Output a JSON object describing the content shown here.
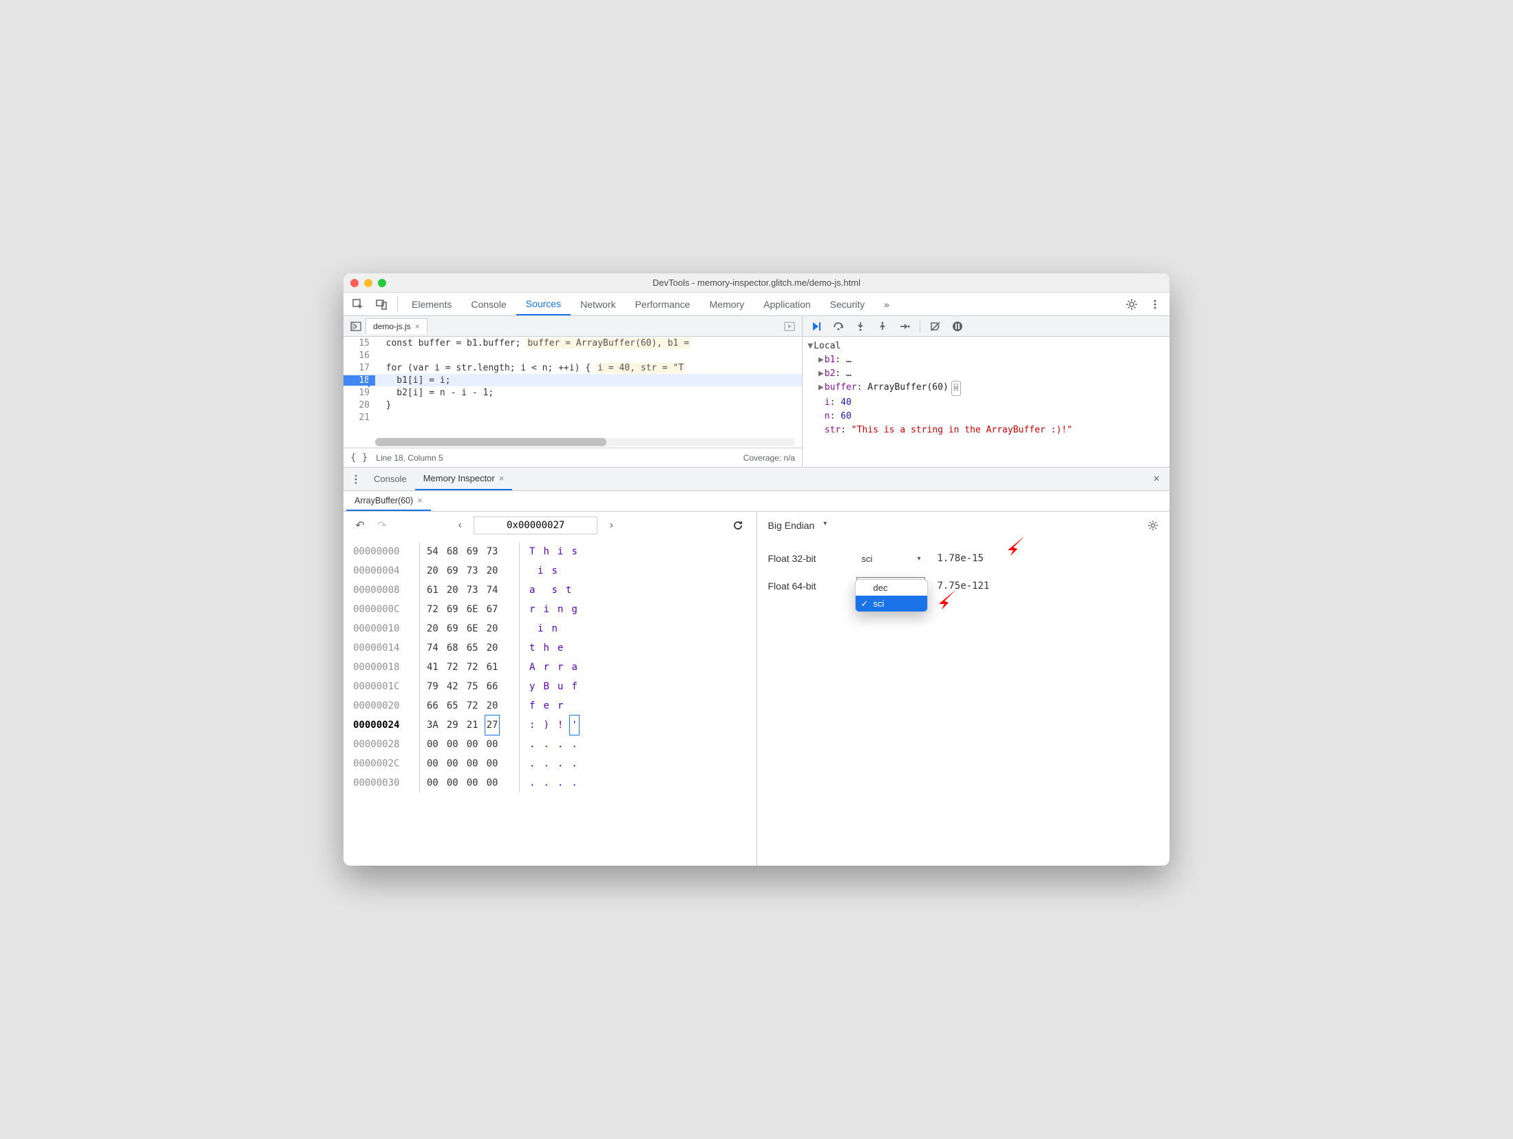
{
  "window": {
    "title": "DevTools - memory-inspector.glitch.me/demo-js.html"
  },
  "main_tabs": {
    "items": [
      "Elements",
      "Console",
      "Sources",
      "Network",
      "Performance",
      "Memory",
      "Application",
      "Security"
    ],
    "active": "Sources",
    "overflow": "»"
  },
  "file_tab": {
    "name": "demo-js.js"
  },
  "code": {
    "lines": [
      {
        "n": 15,
        "text": "const buffer = b1.buffer;",
        "hint": "buffer = ArrayBuffer(60), b1 ="
      },
      {
        "n": 16,
        "text": ""
      },
      {
        "n": 17,
        "text": "for (var i = str.length; i < n; ++i) {",
        "hint": "i = 40, str = \"T"
      },
      {
        "n": 18,
        "text": "  b1[i] = i;",
        "hl": true
      },
      {
        "n": 19,
        "text": "  b2[i] = n - i - 1;"
      },
      {
        "n": 20,
        "text": "}"
      },
      {
        "n": 21,
        "text": ""
      }
    ]
  },
  "status": {
    "pos": "Line 18, Column 5",
    "coverage": "Coverage: n/a"
  },
  "scope": {
    "header": "Local",
    "rows": [
      {
        "arrow": "▶",
        "key": "b1",
        "val": "…"
      },
      {
        "arrow": "▶",
        "key": "b2",
        "val": "…"
      },
      {
        "arrow": "▶",
        "key": "buffer",
        "val": "ArrayBuffer(60)",
        "mem": true
      },
      {
        "arrow": "",
        "key": "i",
        "val": "40",
        "num": true
      },
      {
        "arrow": "",
        "key": "n",
        "val": "60",
        "num": true
      },
      {
        "arrow": "",
        "key": "str",
        "val": "\"This is a string in the ArrayBuffer :)!\"",
        "str": true
      }
    ]
  },
  "drawer_tabs": {
    "items": [
      "Console",
      "Memory Inspector"
    ],
    "active": "Memory Inspector"
  },
  "mi_tab": {
    "label": "ArrayBuffer(60)"
  },
  "mi_nav": {
    "address": "0x00000027"
  },
  "hex": {
    "rows": [
      {
        "off": "00000000",
        "b": [
          "54",
          "68",
          "69",
          "73"
        ],
        "a": [
          "T",
          "h",
          "i",
          "s"
        ]
      },
      {
        "off": "00000004",
        "b": [
          "20",
          "69",
          "73",
          "20"
        ],
        "a": [
          " ",
          "i",
          "s",
          " "
        ]
      },
      {
        "off": "00000008",
        "b": [
          "61",
          "20",
          "73",
          "74"
        ],
        "a": [
          "a",
          " ",
          "s",
          "t"
        ]
      },
      {
        "off": "0000000C",
        "b": [
          "72",
          "69",
          "6E",
          "67"
        ],
        "a": [
          "r",
          "i",
          "n",
          "g"
        ]
      },
      {
        "off": "00000010",
        "b": [
          "20",
          "69",
          "6E",
          "20"
        ],
        "a": [
          " ",
          "i",
          "n",
          " "
        ]
      },
      {
        "off": "00000014",
        "b": [
          "74",
          "68",
          "65",
          "20"
        ],
        "a": [
          "t",
          "h",
          "e",
          " "
        ]
      },
      {
        "off": "00000018",
        "b": [
          "41",
          "72",
          "72",
          "61"
        ],
        "a": [
          "A",
          "r",
          "r",
          "a"
        ]
      },
      {
        "off": "0000001C",
        "b": [
          "79",
          "42",
          "75",
          "66"
        ],
        "a": [
          "y",
          "B",
          "u",
          "f"
        ]
      },
      {
        "off": "00000020",
        "b": [
          "66",
          "65",
          "72",
          "20"
        ],
        "a": [
          "f",
          "e",
          "r",
          " "
        ]
      },
      {
        "off": "00000024",
        "b": [
          "3A",
          "29",
          "21",
          "27"
        ],
        "a": [
          ":",
          ")",
          "!",
          "'"
        ],
        "bold": true,
        "sel": 3
      },
      {
        "off": "00000028",
        "b": [
          "00",
          "00",
          "00",
          "00"
        ],
        "a": [
          ".",
          ".",
          ".",
          "."
        ]
      },
      {
        "off": "0000002C",
        "b": [
          "00",
          "00",
          "00",
          "00"
        ],
        "a": [
          ".",
          ".",
          ".",
          "."
        ]
      },
      {
        "off": "00000030",
        "b": [
          "00",
          "00",
          "00",
          "00"
        ],
        "a": [
          ".",
          ".",
          ".",
          "."
        ]
      }
    ]
  },
  "endian": {
    "label": "Big Endian"
  },
  "values": {
    "float32": {
      "label": "Float 32-bit",
      "mode": "sci",
      "value": "1.78e-15"
    },
    "float64": {
      "label": "Float 64-bit",
      "mode": "sci",
      "value": "7.75e-121"
    }
  },
  "dropdown": {
    "options": [
      "dec",
      "sci"
    ],
    "selected": "sci"
  }
}
